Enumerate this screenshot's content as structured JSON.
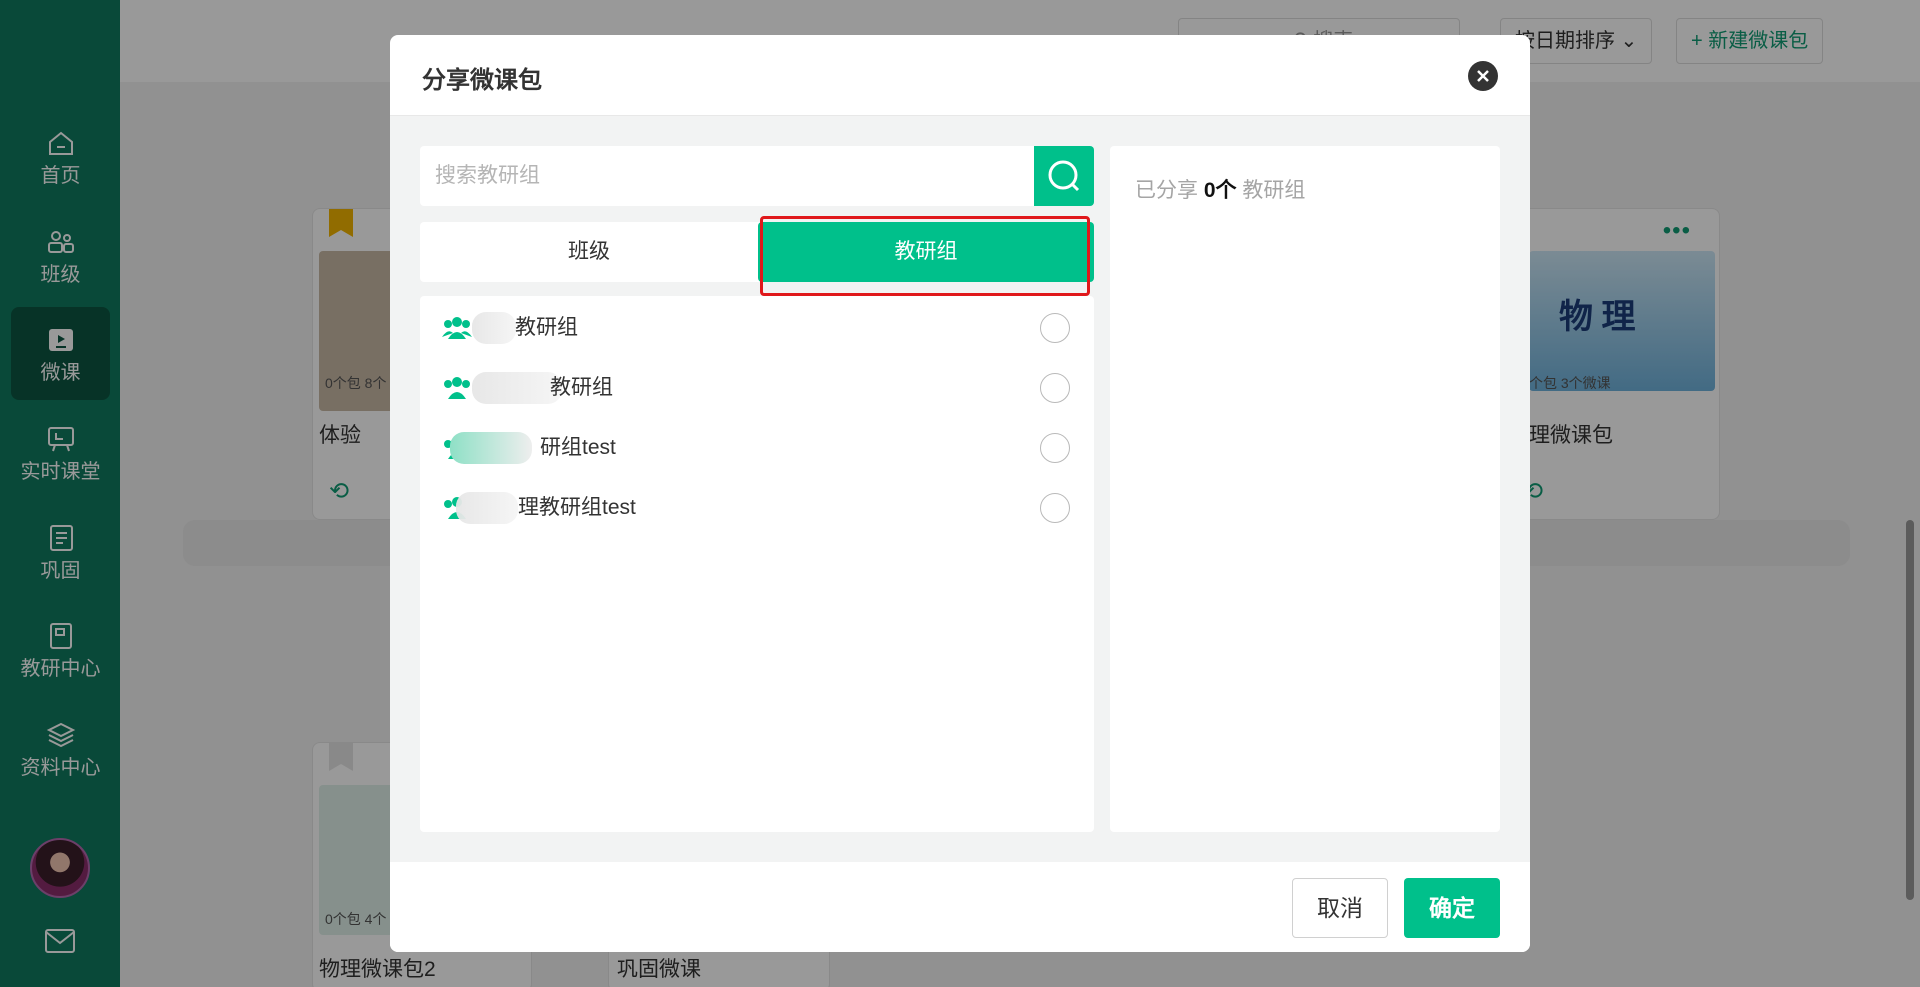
{
  "sidebar": {
    "items": [
      {
        "label": "首页",
        "icon": "home-icon"
      },
      {
        "label": "班级",
        "icon": "users-icon"
      },
      {
        "label": "微课",
        "icon": "video-icon",
        "active": true
      },
      {
        "label": "实时课堂",
        "icon": "classroom-icon"
      },
      {
        "label": "巩固",
        "icon": "notebook-icon"
      },
      {
        "label": "教研中心",
        "icon": "book-icon"
      },
      {
        "label": "资料中心",
        "icon": "layers-icon"
      }
    ]
  },
  "background": {
    "search_label": "搜索",
    "sort_label": "按日期排序",
    "new_package_label": "新建微课包",
    "cards": [
      {
        "stats": "0个包 8个",
        "title": "体验"
      },
      {
        "stats": "个包 3个微课",
        "title": "理微课包",
        "cover_title": "物 理"
      },
      {
        "stats": "0个包 4个",
        "title": "物理微课包2"
      },
      {
        "stats": "",
        "title": "巩固微课"
      }
    ]
  },
  "modal": {
    "title": "分享微课包",
    "search_placeholder": "搜索教研组",
    "tabs": {
      "class": "班级",
      "group": "教研组"
    },
    "groups": [
      {
        "name": "教研组"
      },
      {
        "name": "教研组"
      },
      {
        "name": "研组test"
      },
      {
        "name": "理教研组test"
      }
    ],
    "shared": {
      "prefix": "已分享",
      "count": "0个",
      "suffix": "教研组"
    },
    "cancel_label": "取消",
    "confirm_label": "确定"
  },
  "colors": {
    "accent": "#00c08b",
    "sidebar": "#0f7b5f",
    "highlight": "#e0181b"
  }
}
